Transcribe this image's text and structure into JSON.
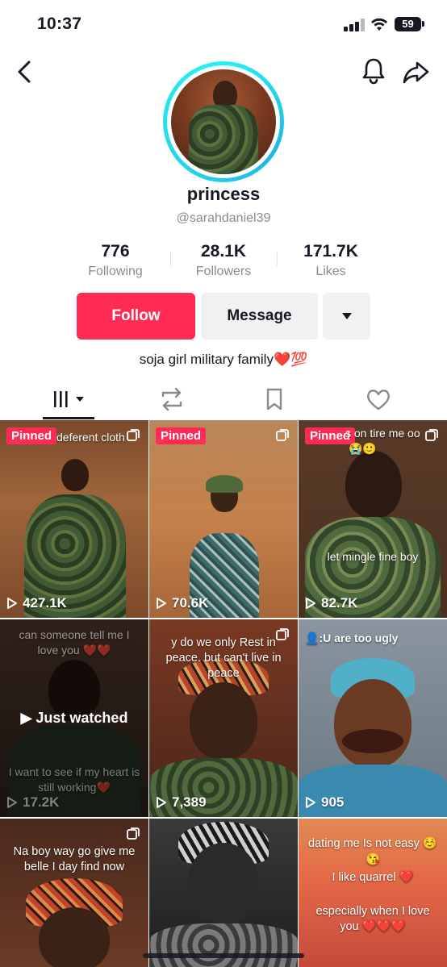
{
  "status_bar": {
    "time": "10:37",
    "battery": "59"
  },
  "profile": {
    "display_name": "princess",
    "handle": "@sarahdaniel39",
    "bio": "soja girl military family❤️💯"
  },
  "stats": [
    {
      "value": "776",
      "label": "Following"
    },
    {
      "value": "28.1K",
      "label": "Followers"
    },
    {
      "value": "171.7K",
      "label": "Likes"
    }
  ],
  "actions": {
    "follow_label": "Follow",
    "message_label": "Message"
  },
  "tabs": [
    {
      "name": "videos-tab",
      "icon": "grid-icon",
      "active": true
    },
    {
      "name": "reposts-tab",
      "icon": "repost-icon",
      "active": false
    },
    {
      "name": "favorites-tab",
      "icon": "bookmark-icon",
      "active": false
    },
    {
      "name": "liked-tab",
      "icon": "heart-icon",
      "active": false
    }
  ],
  "videos": [
    {
      "pinned_label": "Pinned",
      "caption": "deferent cloth",
      "views": "427.1K"
    },
    {
      "pinned_label": "Pinned",
      "views": "70.6K"
    },
    {
      "pinned_label": "Pinned",
      "caption": "s on tire me oo",
      "caption2": "😭🙂",
      "caption3": "let mingle fine boy",
      "views": "82.7K"
    },
    {
      "caption": "can someone tell me I love you ❤️❤️",
      "caption2": "I want to see if my heart is still working❤️",
      "status": "Just watched",
      "views": "17.2K"
    },
    {
      "caption": "y do we only Rest in peace. but can't live in peace",
      "views": "7,389"
    },
    {
      "caption": "👤:U are too ugly",
      "views": "905"
    },
    {
      "caption": "Na boy way go give me belle I day find now"
    },
    {
      "caption": ""
    },
    {
      "caption": "dating me Is not easy ☺️",
      "caption2": "😘",
      "caption3": "I like quarrel ❤️",
      "caption4": "especially when I love you ❤️❤️❤️"
    }
  ],
  "colors": {
    "accent": "#fe2c55",
    "ring": "#25f4ee",
    "text": "#161823",
    "muted": "#8a8b91"
  }
}
